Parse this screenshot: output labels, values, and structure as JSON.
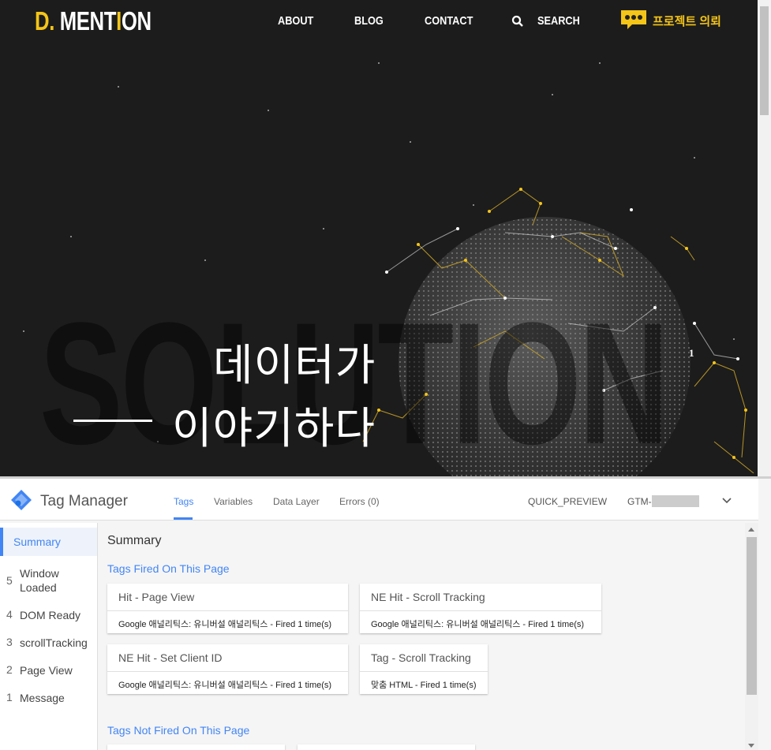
{
  "site": {
    "logo": {
      "d": "D.",
      "rest1": " MENT",
      "i": "I",
      "rest2": "ON"
    },
    "nav": {
      "about": "ABOUT",
      "blog": "BLOG",
      "contact": "CONTACT",
      "search": "SEARCH",
      "request": "프로젝트 의뢰"
    },
    "hero": {
      "line1": "데이터가",
      "line2": "이야기하다",
      "watermark": "SOLUTION",
      "slide_number": "1"
    },
    "colors": {
      "accent": "#f5c518",
      "background": "#1c1c1c"
    }
  },
  "gtm": {
    "title": "Tag Manager",
    "tabs": [
      "Tags",
      "Variables",
      "Data Layer",
      "Errors (0)"
    ],
    "active_tab": "Tags",
    "quick_preview": "QUICK_PREVIEW",
    "container_id": "GTM-",
    "sidebar": [
      {
        "num": "",
        "label": "Summary"
      },
      {
        "num": "5",
        "label": "Window Loaded"
      },
      {
        "num": "4",
        "label": "DOM Ready"
      },
      {
        "num": "3",
        "label": "scrollTracking"
      },
      {
        "num": "2",
        "label": "Page View"
      },
      {
        "num": "1",
        "label": "Message"
      }
    ],
    "summary_title": "Summary",
    "fired_title": "Tags Fired On This Page",
    "not_fired_title": "Tags Not Fired On This Page",
    "fired_tags": [
      {
        "name": "Hit - Page View",
        "detail": "Google 애널리틱스: 유니버설 애널리틱스 - Fired 1 time(s)"
      },
      {
        "name": "NE Hit - Scroll Tracking",
        "detail": "Google 애널리틱스: 유니버설 애널리틱스 - Fired 1 time(s)"
      },
      {
        "name": "NE Hit - Set Client ID",
        "detail": "Google 애널리틱스: 유니버설 애널리틱스 - Fired 1 time(s)"
      },
      {
        "name": "Tag - Scroll Tracking",
        "detail": "맞춤 HTML - Fired 1 time(s)"
      }
    ],
    "colors": {
      "accent": "#4285f4"
    }
  }
}
